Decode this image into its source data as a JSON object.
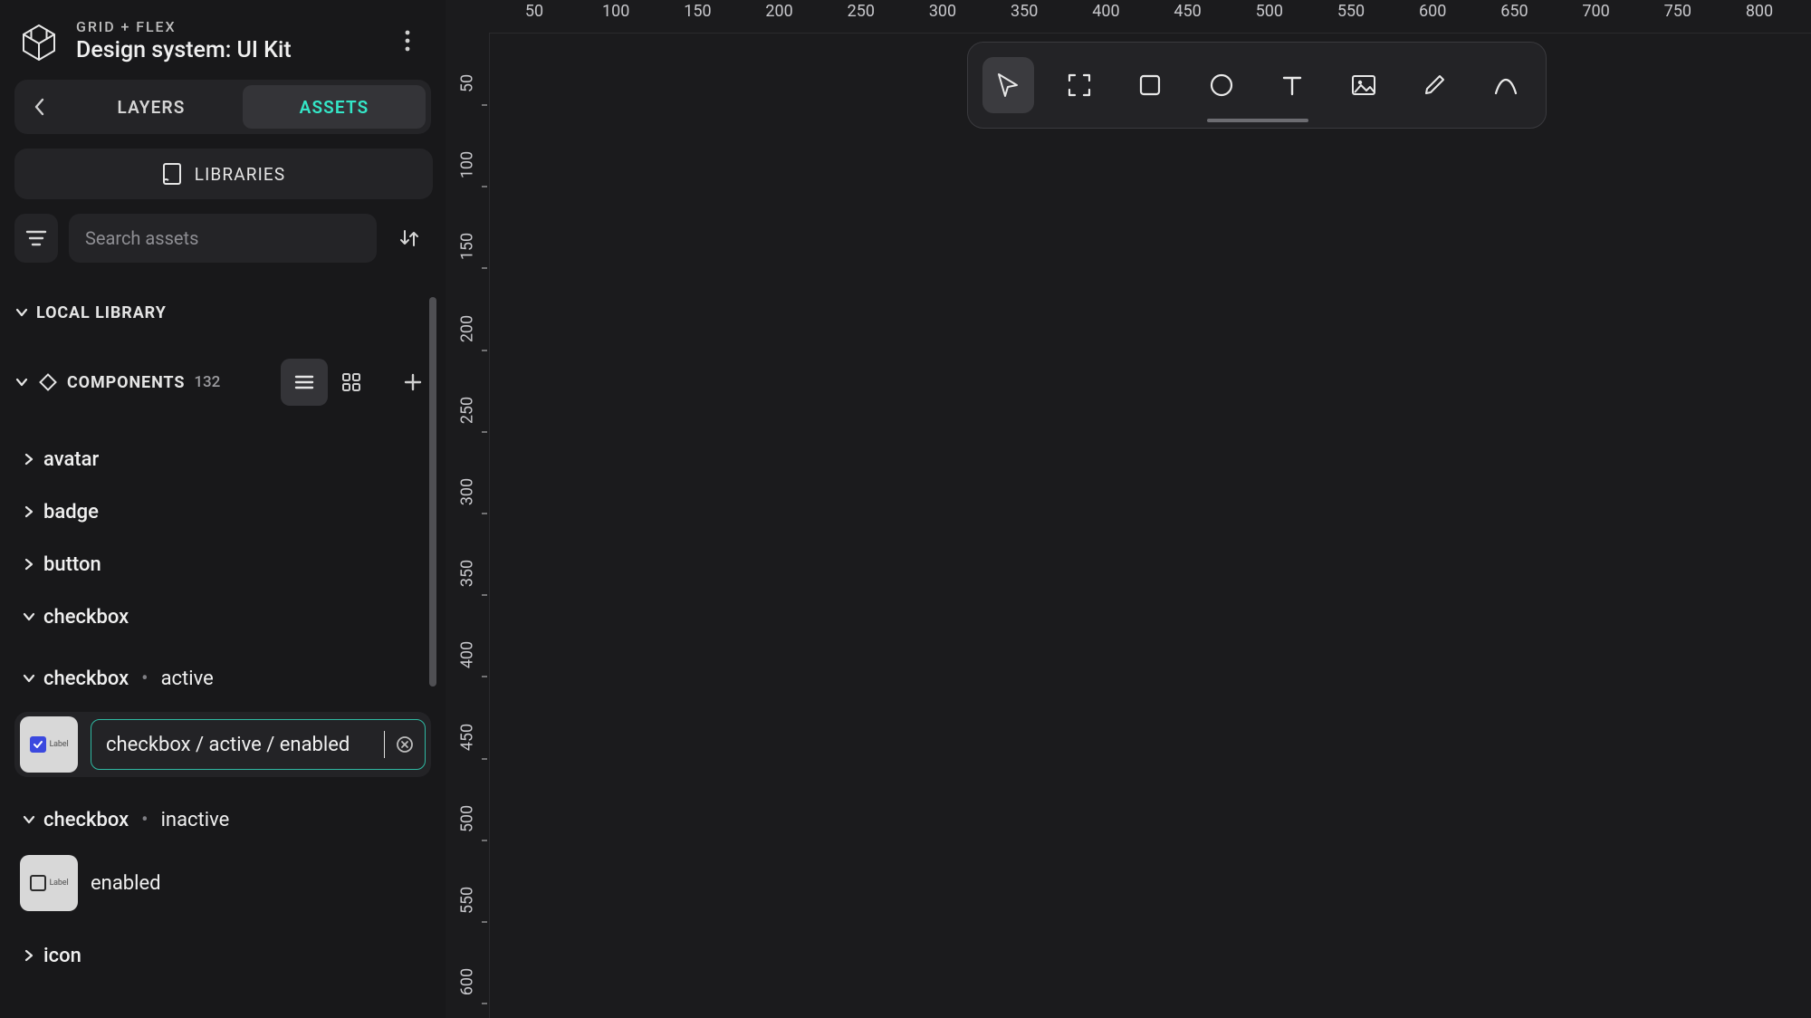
{
  "header": {
    "subtitle": "GRID + FLEX",
    "title": "Design system: UI Kit"
  },
  "sidebar": {
    "tabs": {
      "layers": "LAYERS",
      "assets": "ASSETS"
    },
    "libraries_label": "LIBRARIES",
    "search_placeholder": "Search assets",
    "local_library_label": "LOCAL LIBRARY",
    "components_label": "COMPONENTS",
    "components_count": "132",
    "list": {
      "avatar": "avatar",
      "badge": "badge",
      "button": "button",
      "checkbox": "checkbox",
      "checkbox_active": {
        "name": "checkbox",
        "variant": "active"
      },
      "checkbox_active_edit_value": "checkbox / active / enabled",
      "checkbox_inactive": {
        "name": "checkbox",
        "variant": "inactive"
      },
      "checkbox_inactive_instance_label": "enabled",
      "icon": "icon"
    },
    "thumb_label": "Label"
  },
  "ruler_h": [
    "50",
    "100",
    "150",
    "200",
    "250",
    "300",
    "350",
    "400",
    "450",
    "500",
    "550",
    "600",
    "650",
    "700",
    "750",
    "800"
  ],
  "ruler_v": [
    "50",
    "100",
    "150",
    "200",
    "250",
    "300",
    "350",
    "400",
    "450",
    "500",
    "550",
    "600"
  ],
  "toolbar": {
    "tools": [
      "select",
      "frame",
      "rectangle",
      "ellipse",
      "text",
      "image",
      "pen",
      "curve"
    ]
  },
  "colors": {
    "accent": "#34e6c7",
    "panel": "#242427",
    "panel_light": "#343438",
    "canvas": "#1b1b1d",
    "border_edit": "#2fb9a2"
  }
}
